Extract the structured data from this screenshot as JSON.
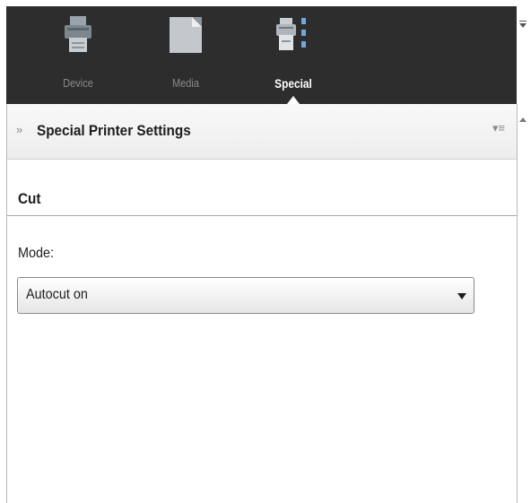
{
  "tabs": [
    {
      "label": "Device",
      "icon": "printer-icon",
      "active": false
    },
    {
      "label": "Media",
      "icon": "media-icon",
      "active": false
    },
    {
      "label": "Special",
      "icon": "special-settings-icon",
      "active": true
    }
  ],
  "section": {
    "title": "Special Printer Settings",
    "collapse_icon": "double-chevron-icon",
    "menu_icon": "options-menu-icon"
  },
  "cut": {
    "group_title": "Cut",
    "mode_label": "Mode:",
    "mode_value": "Autocut on"
  },
  "colors": {
    "toolbar_bg": "#2d2d2d",
    "inactive_tab_text": "#8a8a8a",
    "active_tab_text": "#ffffff"
  }
}
